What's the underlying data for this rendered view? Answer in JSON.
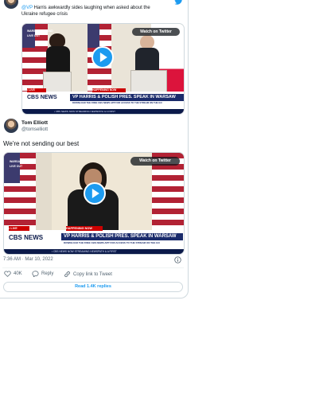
{
  "quoted_tweet": {
    "text_line1_partial": "…Harris awkwardly sides laughing when asked about the",
    "mention": "@VP",
    "text_line1_rest": " Harris awkwardly sides laughing when asked about the",
    "text_line2": "Ukraine refugee crisis",
    "video": {
      "watch_label": "Watch on Twitter",
      "corner_bug": [
        "WARSAW, POLAND",
        "LIVE OUT"
      ],
      "live_label": "• LIVE",
      "breaking_label": "HAPPENING NOW",
      "network": "CBS NEWS",
      "headline": "VP HARRIS & POLISH PRES. SPEAK IN WARSAW",
      "subline": "DOWNLOAD THE FREE CBS NEWS APP FOR ACCESS TO THE STREAM ON THE GO",
      "ticker": "• CBS NEWS NOW STREAMING NEWSPATH & A FIRST"
    }
  },
  "author": {
    "name": "Tom Elliott",
    "handle": "@tomselliott"
  },
  "tweet": {
    "text": "We're not sending our best",
    "video": {
      "watch_label": "Watch on Twitter",
      "corner_bug": [
        "WARSAW, POLAND",
        "LIVE OUT"
      ],
      "live_label": "• LIVE",
      "breaking_label": "HAPPENING NOW",
      "network": "CBS NEWS",
      "headline": "VP HARRIS & POLISH PRES. SPEAK IN WARSAW",
      "subline": "DOWNLOAD THE FREE CBS NEWS APP FOR ACCESS TO THE STREAM ON THE GO",
      "ticker": "• CBS NEWS NOW STREAMING NEWSPATH & A FIRST"
    },
    "timestamp": "7:36 AM · Mar 10, 2022"
  },
  "actions": {
    "like_count": "40K",
    "reply_label": "Reply",
    "copy_link_label": "Copy link to Tweet",
    "read_replies_label": "Read 1.4K replies"
  },
  "colors": {
    "accent": "#1d9bf0",
    "border": "#cfd9de",
    "text": "#0f1419",
    "muted": "#536471"
  }
}
